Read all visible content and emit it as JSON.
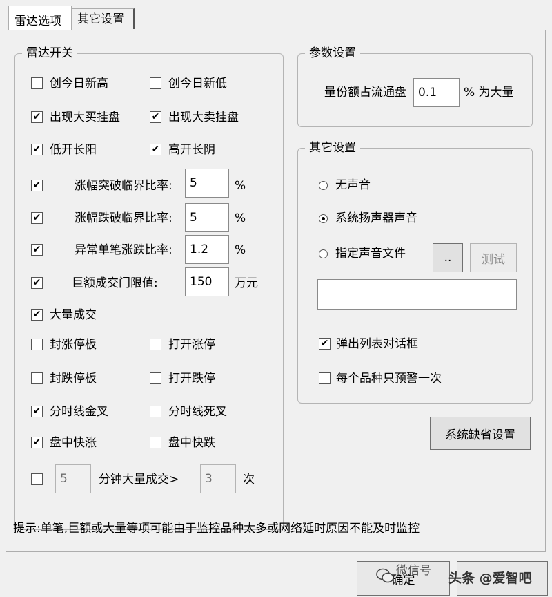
{
  "tabs": [
    {
      "label": "雷达选项",
      "active": true
    },
    {
      "label": "其它设置",
      "active": false
    }
  ],
  "radar": {
    "title": "雷达开关",
    "items": [
      {
        "label": "创今日新高",
        "checked": false
      },
      {
        "label": "创今日新低",
        "checked": false
      },
      {
        "label": "出现大买挂盘",
        "checked": true
      },
      {
        "label": "出现大卖挂盘",
        "checked": true
      },
      {
        "label": "低开长阳",
        "checked": true
      },
      {
        "label": "高开长阴",
        "checked": true
      },
      {
        "label": "涨幅突破临界比率:",
        "checked": true,
        "value": "5",
        "unit": "%"
      },
      {
        "label": "涨幅跌破临界比率:",
        "checked": true,
        "value": "5",
        "unit": "%"
      },
      {
        "label": "异常单笔涨跌比率:",
        "checked": true,
        "value": "1.2",
        "unit": "%"
      },
      {
        "label": "巨额成交门限值:",
        "checked": true,
        "value": "150",
        "unit": "万元"
      },
      {
        "label": "大量成交",
        "checked": true
      },
      {
        "label": "封涨停板",
        "checked": false
      },
      {
        "label": "打开涨停",
        "checked": false
      },
      {
        "label": "封跌停板",
        "checked": false
      },
      {
        "label": "打开跌停",
        "checked": false
      },
      {
        "label": "分时线金叉",
        "checked": true
      },
      {
        "label": "分时线死叉",
        "checked": false
      },
      {
        "label": "盘中快涨",
        "checked": true
      },
      {
        "label": "盘中快跌",
        "checked": false
      }
    ],
    "minute_volume": {
      "checked": false,
      "minutes": "5",
      "label": "分钟大量成交>",
      "times": "3",
      "unit": "次"
    }
  },
  "params": {
    "title": "参数设置",
    "label": "量份额占流通盘",
    "value": "0.1",
    "unit": "% 为大量"
  },
  "other": {
    "title": "其它设置",
    "sound_options": [
      {
        "label": "无声音",
        "selected": false
      },
      {
        "label": "系统扬声器声音",
        "selected": true
      },
      {
        "label": "指定声音文件",
        "selected": false
      }
    ],
    "browse_label": "..",
    "test_label": "测试",
    "file_path": "",
    "popup": {
      "label": "弹出列表对话框",
      "checked": true
    },
    "once": {
      "label": "每个品种只预警一次",
      "checked": false
    }
  },
  "default_button": "系统缺省设置",
  "hint": "提示:单笔,巨额或大量等项可能由于监控品种太多或网络延时原因不能及时监控",
  "ok_button": "确定",
  "watermark": "头条 @爱智吧",
  "watermark2": "微信号"
}
